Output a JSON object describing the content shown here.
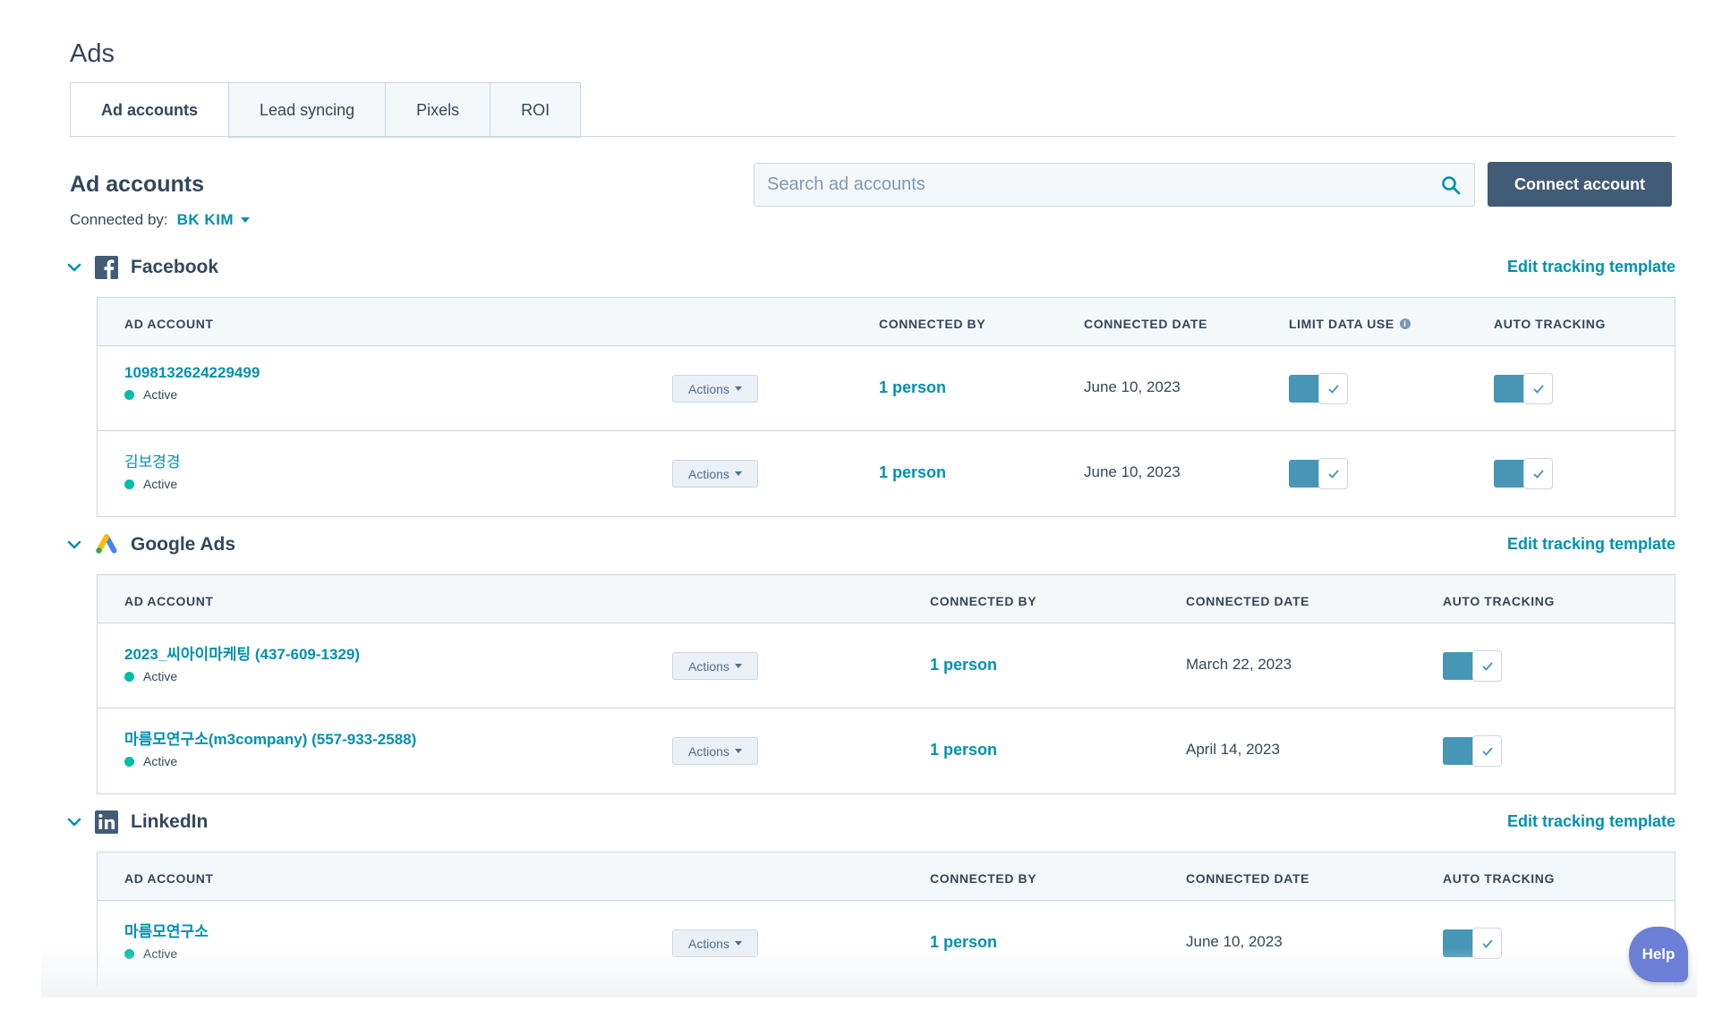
{
  "page": {
    "title": "Ads"
  },
  "tabs": [
    {
      "label": "Ad accounts",
      "active": true
    },
    {
      "label": "Lead syncing"
    },
    {
      "label": "Pixels"
    },
    {
      "label": "ROI"
    }
  ],
  "section": {
    "title": "Ad accounts",
    "connected_by_label": "Connected by:",
    "connected_by_user": "BK KIM"
  },
  "search": {
    "placeholder": "Search ad accounts"
  },
  "connect_button": "Connect account",
  "colors": {
    "accent": "#0091ae",
    "toggle_on": "#4796b5",
    "active_dot": "#00bda5",
    "primary_button": "#425b76"
  },
  "platforms": [
    {
      "name": "Facebook",
      "edit_link": "Edit tracking template",
      "headers": {
        "account": "AD ACCOUNT",
        "connected_by": "CONNECTED BY",
        "connected_date": "CONNECTED DATE",
        "limit_data_use": "LIMIT DATA USE",
        "auto_tracking": "AUTO TRACKING"
      },
      "rows": [
        {
          "account": "1098132624229499",
          "status": "Active",
          "actions": "Actions",
          "connected_by": "1 person",
          "date": "June 10, 2023"
        },
        {
          "account": "김보경경",
          "status": "Active",
          "actions": "Actions",
          "connected_by": "1 person",
          "date": "June 10, 2023"
        }
      ]
    },
    {
      "name": "Google Ads",
      "edit_link": "Edit tracking template",
      "headers": {
        "account": "AD ACCOUNT",
        "connected_by": "CONNECTED BY",
        "connected_date": "CONNECTED DATE",
        "auto_tracking": "AUTO TRACKING"
      },
      "rows": [
        {
          "account": "2023_씨아이마케팅 (437-609-1329)",
          "status": "Active",
          "actions": "Actions",
          "connected_by": "1 person",
          "date": "March 22, 2023"
        },
        {
          "account": "마름모연구소(m3company) (557-933-2588)",
          "status": "Active",
          "actions": "Actions",
          "connected_by": "1 person",
          "date": "April 14, 2023"
        }
      ]
    },
    {
      "name": "LinkedIn",
      "edit_link": "Edit tracking template",
      "headers": {
        "account": "AD ACCOUNT",
        "connected_by": "CONNECTED BY",
        "connected_date": "CONNECTED DATE",
        "auto_tracking": "AUTO TRACKING"
      },
      "rows": [
        {
          "account": "마름모연구소",
          "status": "Active",
          "actions": "Actions",
          "connected_by": "1 person",
          "date": "June 10, 2023"
        }
      ]
    }
  ],
  "help_button": "Help"
}
